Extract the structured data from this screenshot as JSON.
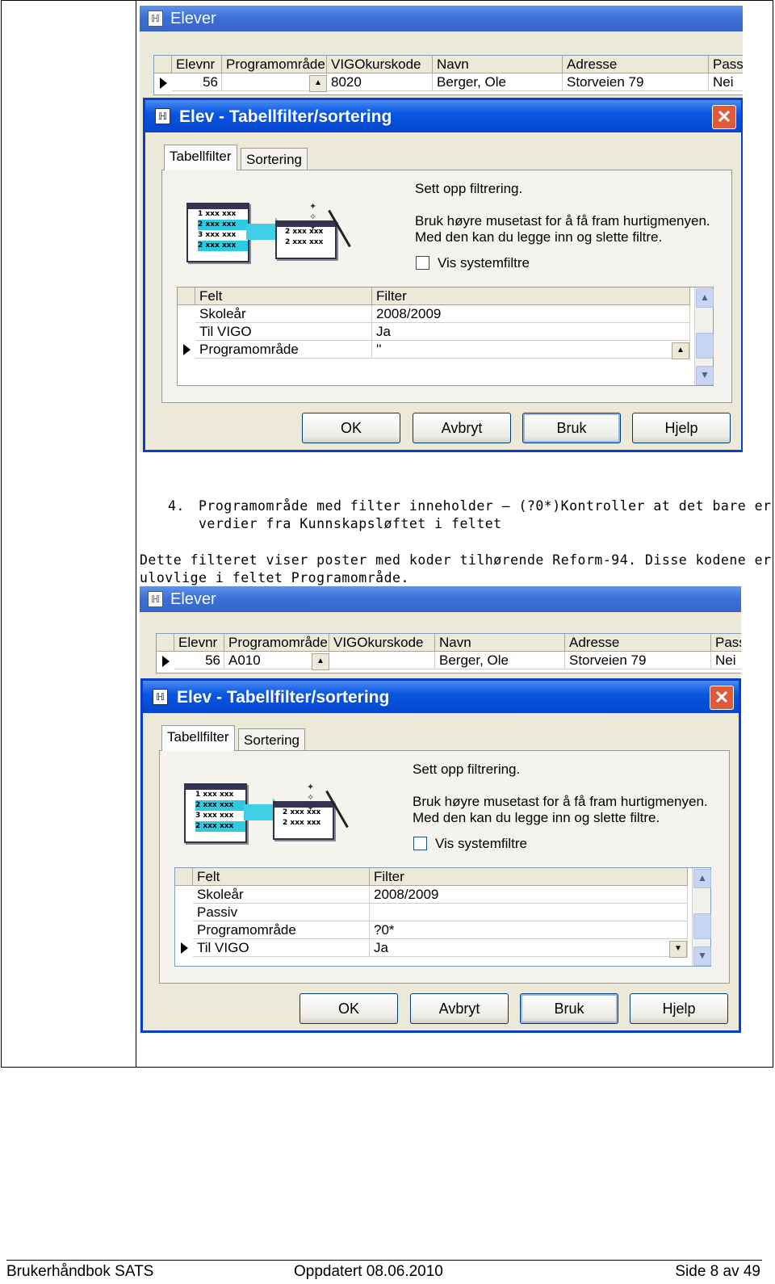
{
  "screenshot1": {
    "bg_window_title": "Elever",
    "bg_grid": {
      "headers": [
        "Elevnr",
        "Programområde",
        "VIGOkurskode",
        "Navn",
        "Adresse",
        "Pass"
      ],
      "row": [
        "56",
        "",
        "8020",
        "Berger, Ole",
        "Storveien 79",
        "Nei"
      ]
    },
    "dialog": {
      "title": "Elev - Tabellfilter/sortering",
      "tabs": [
        "Tabellfilter",
        "Sortering"
      ],
      "heading": "Sett opp filtrering.",
      "hint_line1": "Bruk høyre musetast for å få fram hurtigmenyen.",
      "hint_line2": "Med den kan du legge inn og slette filtre.",
      "checkbox_label": "Vis systemfiltre",
      "filter_headers": [
        "Felt",
        "Filter"
      ],
      "filter_rows": [
        {
          "felt": "Skoleår",
          "filter": "2008/2009"
        },
        {
          "felt": "Til VIGO",
          "filter": "Ja"
        },
        {
          "felt": "Programområde",
          "filter": "''"
        }
      ],
      "buttons": [
        "OK",
        "Avbryt",
        "Bruk",
        "Hjelp"
      ]
    }
  },
  "step_text": {
    "number": "4.",
    "line1": "Programområde med filter inneholder – (?0*)Kontroller at det bare er",
    "line2": "verdier fra Kunnskapsløftet i feltet"
  },
  "para": {
    "line1": "Dette filteret viser poster med koder tilhørende Reform-94.  Disse kodene er",
    "line2": "ulovlige i feltet Programområde."
  },
  "screenshot2": {
    "bg_window_title": "Elever",
    "bg_grid": {
      "headers": [
        "Elevnr",
        "Programområde",
        "VIGOkurskode",
        "Navn",
        "Adresse",
        "Pass"
      ],
      "row": [
        "56",
        "A010",
        "",
        "Berger, Ole",
        "Storveien 79",
        "Nei"
      ]
    },
    "dialog": {
      "title": "Elev - Tabellfilter/sortering",
      "tabs": [
        "Tabellfilter",
        "Sortering"
      ],
      "heading": "Sett opp filtrering.",
      "hint_line1": "Bruk høyre musetast for å få fram hurtigmenyen.",
      "hint_line2": "Med den kan du legge inn og slette filtre.",
      "checkbox_label": "Vis systemfiltre",
      "filter_headers": [
        "Felt",
        "Filter"
      ],
      "filter_rows": [
        {
          "felt": "Skoleår",
          "filter": "2008/2009"
        },
        {
          "felt": "Passiv",
          "filter": ""
        },
        {
          "felt": "Programområde",
          "filter": "?0*"
        },
        {
          "felt": "Til VIGO",
          "filter": "Ja"
        }
      ],
      "buttons": [
        "OK",
        "Avbryt",
        "Bruk",
        "Hjelp"
      ]
    }
  },
  "illustration": {
    "left_rows": [
      "1 xxx xxx",
      "2 xxx xxx",
      "3 xxx xxx",
      "2 xxx xxx"
    ],
    "right_rows": [
      "2 xxx xxx",
      "2 xxx xxx"
    ]
  },
  "footer": {
    "left": "Brukerhåndbok SATS",
    "middle": "Oppdatert  08.06.2010",
    "right": "Side 8 av 49"
  }
}
